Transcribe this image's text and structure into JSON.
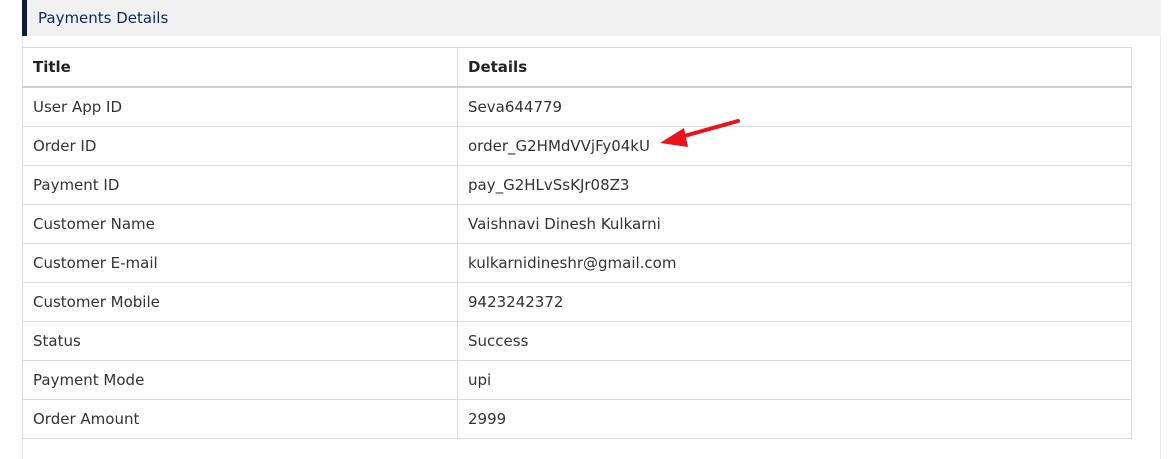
{
  "panel": {
    "title": "Payments Details"
  },
  "table": {
    "headers": [
      "Title",
      "Details"
    ],
    "rows": [
      {
        "title": "User App ID",
        "details": "Seva644779"
      },
      {
        "title": "Order ID",
        "details": "order_G2HMdVVjFy04kU"
      },
      {
        "title": "Payment ID",
        "details": "pay_G2HLvSsKJr08Z3"
      },
      {
        "title": "Customer Name",
        "details": "Vaishnavi Dinesh Kulkarni"
      },
      {
        "title": "Customer E-mail",
        "details": "kulkarnidineshr@gmail.com"
      },
      {
        "title": "Customer Mobile",
        "details": "9423242372"
      },
      {
        "title": "Status",
        "details": "Success"
      },
      {
        "title": "Payment Mode",
        "details": "upi"
      },
      {
        "title": "Order Amount",
        "details": "2999"
      }
    ]
  },
  "annotation": {
    "icon": "red-arrow-icon",
    "color": "#e8141a"
  }
}
